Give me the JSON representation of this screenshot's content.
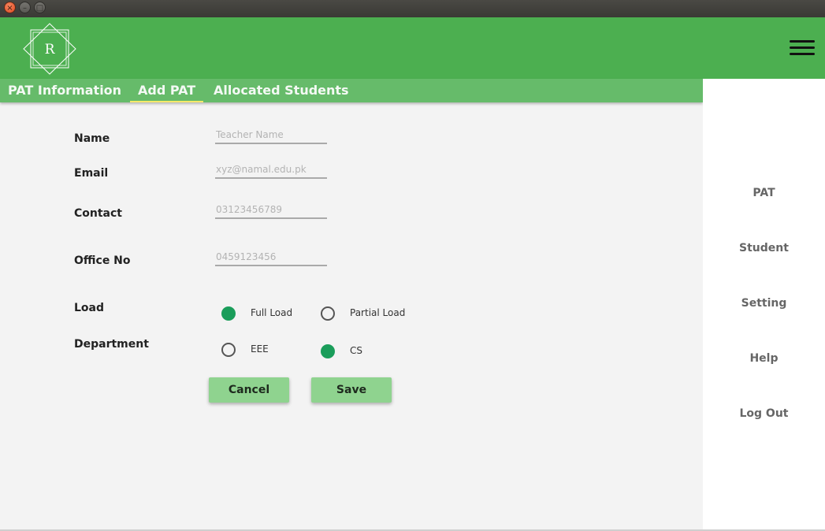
{
  "window": {
    "close_glyph": "×",
    "minimize_glyph": "–",
    "maximize_glyph": "□"
  },
  "header": {
    "logo_letter": "R",
    "accent_color": "#4caf50"
  },
  "tabs": [
    {
      "label": "PAT Information",
      "active": false
    },
    {
      "label": "Add PAT",
      "active": true
    },
    {
      "label": "Allocated Students",
      "active": false
    }
  ],
  "form": {
    "name": {
      "label": "Name",
      "placeholder": "Teacher Name"
    },
    "email": {
      "label": "Email",
      "placeholder": "xyz@namal.edu.pk"
    },
    "contact": {
      "label": "Contact",
      "placeholder": "03123456789"
    },
    "office": {
      "label": "Office No",
      "placeholder": "0459123456"
    },
    "load": {
      "label": "Load",
      "options": [
        {
          "label": "Full Load",
          "selected": true
        },
        {
          "label": "Partial Load",
          "selected": false
        }
      ]
    },
    "department": {
      "label": "Department",
      "options": [
        {
          "label": "EEE",
          "selected": false
        },
        {
          "label": "CS",
          "selected": true
        }
      ]
    },
    "cancel_label": "Cancel",
    "save_label": "Save"
  },
  "sidebar": {
    "items": [
      {
        "label": "PAT"
      },
      {
        "label": "Student"
      },
      {
        "label": "Setting"
      },
      {
        "label": "Help"
      },
      {
        "label": "Log Out"
      }
    ]
  }
}
